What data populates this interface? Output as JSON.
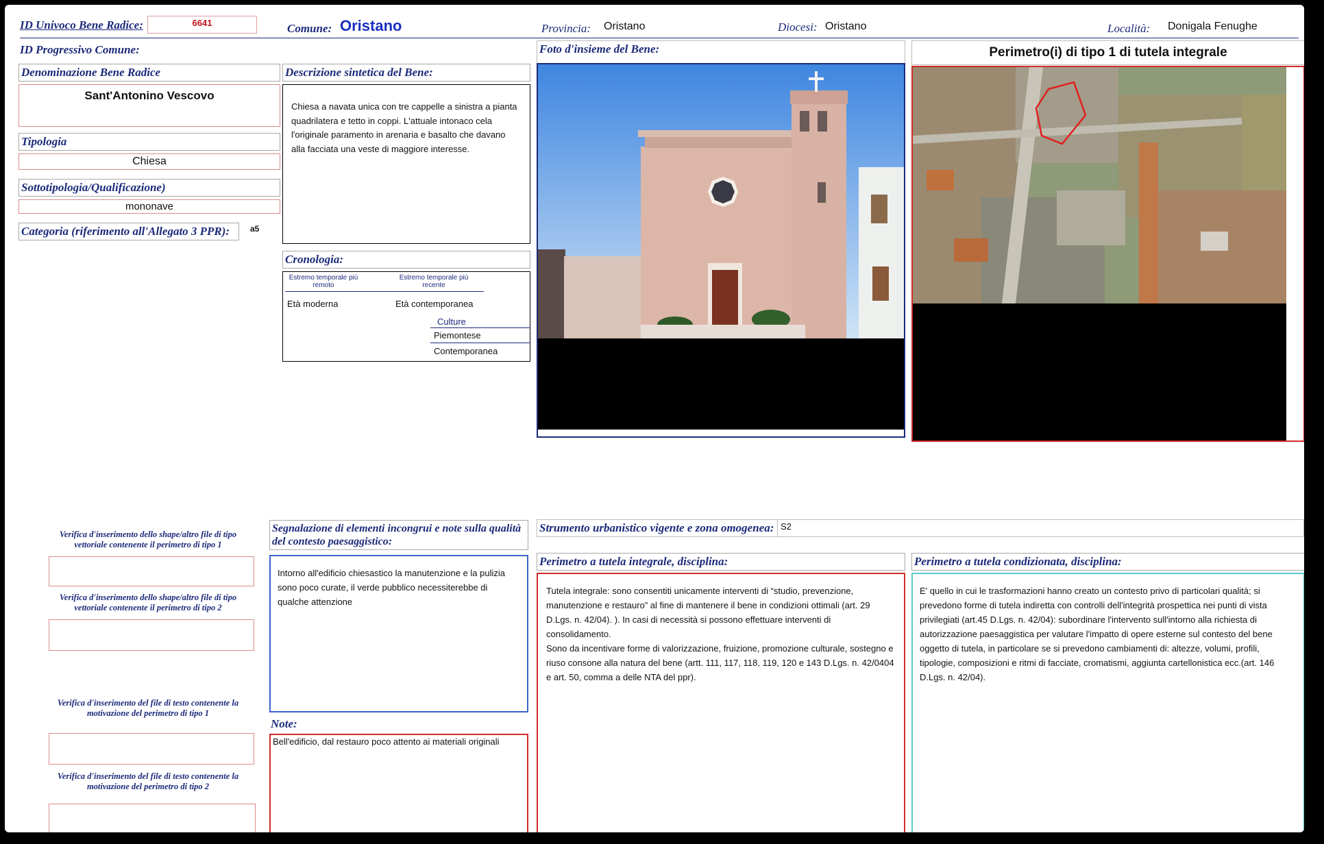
{
  "header": {
    "id_univoco_label": "ID Univoco Bene Radice:",
    "id_univoco_value": "6641",
    "comune_label": "Comune:",
    "comune_value": "Oristano",
    "provincia_label": "Provincia:",
    "provincia_value": "Oristano",
    "diocesi_label": "Diocesi:",
    "diocesi_value": "Oristano",
    "localita_label": "Località:",
    "localita_value": "Donigala Fenughe",
    "id_progressivo_label": "ID Progressivo Comune:"
  },
  "left": {
    "denominazione_label": "Denominazione Bene Radice",
    "denominazione_value": "Sant'Antonino Vescovo",
    "tipologia_label": "Tipologia",
    "tipologia_value": "Chiesa",
    "sottotipologia_label": "Sottotipologia/Qualificazione)",
    "sottotipologia_value": "mononave",
    "categoria_label": "Categoria (riferimento all'Allegato 3 PPR):",
    "categoria_value": "a5"
  },
  "descrizione": {
    "label": "Descrizione sintetica del Bene:",
    "text": "Chiesa  a navata unica con tre cappelle a sinistra a pianta quadrilatera e tetto in coppi. L'attuale intonaco cela l'originale paramento in arenaria e basalto che davano alla facciata una veste di maggiore interesse."
  },
  "cronologia": {
    "label": "Cronologia:",
    "col1_header": "Estremo temporale più remoto",
    "col2_header": "Estremo temporale più recente",
    "col1_value": "Età moderna",
    "col2_value": "Età contemporanea",
    "culture_label": "Culture",
    "culture_items": [
      "Piemontese",
      "Contemporanea"
    ]
  },
  "foto": {
    "label": "Foto d'insieme del Bene:"
  },
  "perimetro": {
    "title": "Perimetro(i) di tipo 1 di tutela integrale"
  },
  "verifiche": [
    "Verifica d'inserimento dello shape/altro file di tipo vettoriale contenente il perimetro di tipo 1",
    "Verifica d'inserimento dello shape/altro file di tipo vettoriale contenente il perimetro di tipo 2",
    "Verifica d'inserimento del  file di testo contenente la motivazione del perimetro di tipo 1",
    "Verifica d'inserimento del  file di testo contenente la motivazione del perimetro di tipo 2"
  ],
  "segnalazione": {
    "label": "Segnalazione di elementi incongrui e note sulla qualità del contesto paesaggistico:",
    "text": "Intorno all'edificio chiesastico la manutenzione e la pulizia sono poco curate, il verde pubblico necessiterebbe di qualche attenzione"
  },
  "note": {
    "label": "Note:",
    "text": "Bell'edificio, dal restauro poco attento ai materiali originali"
  },
  "strumento": {
    "label": "Strumento urbanistico vigente e zona omogenea:",
    "value": "S2"
  },
  "tutela_integrale": {
    "label": "Perimetro a tutela integrale, disciplina:",
    "text": "Tutela integrale: sono consentiti unicamente interventi di “studio, prevenzione, manutenzione e restauro”  al fine di mantenere il bene in  condizioni ottimali (art. 29 D.Lgs. n. 42/04). ). In casi di necessità si possono effettuare interventi di consolidamento.\nSono da incentivare forme di valorizzazione, fruizione, promozione culturale, sostegno e riuso consone alla natura del bene (artt. 111, 117, 118, 119, 120 e   143 D.Lgs. n. 42/0404 e art. 50, comma a delle NTA del ppr)."
  },
  "tutela_condizionata": {
    "label": "Perimetro a tutela condizionata, disciplina:",
    "text": "E' quello in cui le trasformazioni hanno creato un contesto privo di particolari qualità; si prevedono  forme di tutela indiretta con controlli dell'integrità prospettica nei punti di vista privilegiati (art.45  D.Lgs. n. 42/04): subordinare l'intervento sull'intorno alla richiesta di autorizzazione paesaggistica per valutare l'impatto di opere esterne sul contesto del bene oggetto di tutela, in particolare se si prevedono cambiamenti di:  altezze, volumi, profili, tipologie, composizioni e ritmi di facciate, cromatismi, aggiunta cartellonistica ecc.(art. 146 D.Lgs. n. 42/04)."
  },
  "colors": {
    "label_blue": "#1c2a7a",
    "comune_blue": "#1a2fc0",
    "id_red": "#c0141c",
    "border_red": "#d42a2a",
    "border_blue": "#1c2a7a",
    "border_teal": "#5ac8c8"
  }
}
